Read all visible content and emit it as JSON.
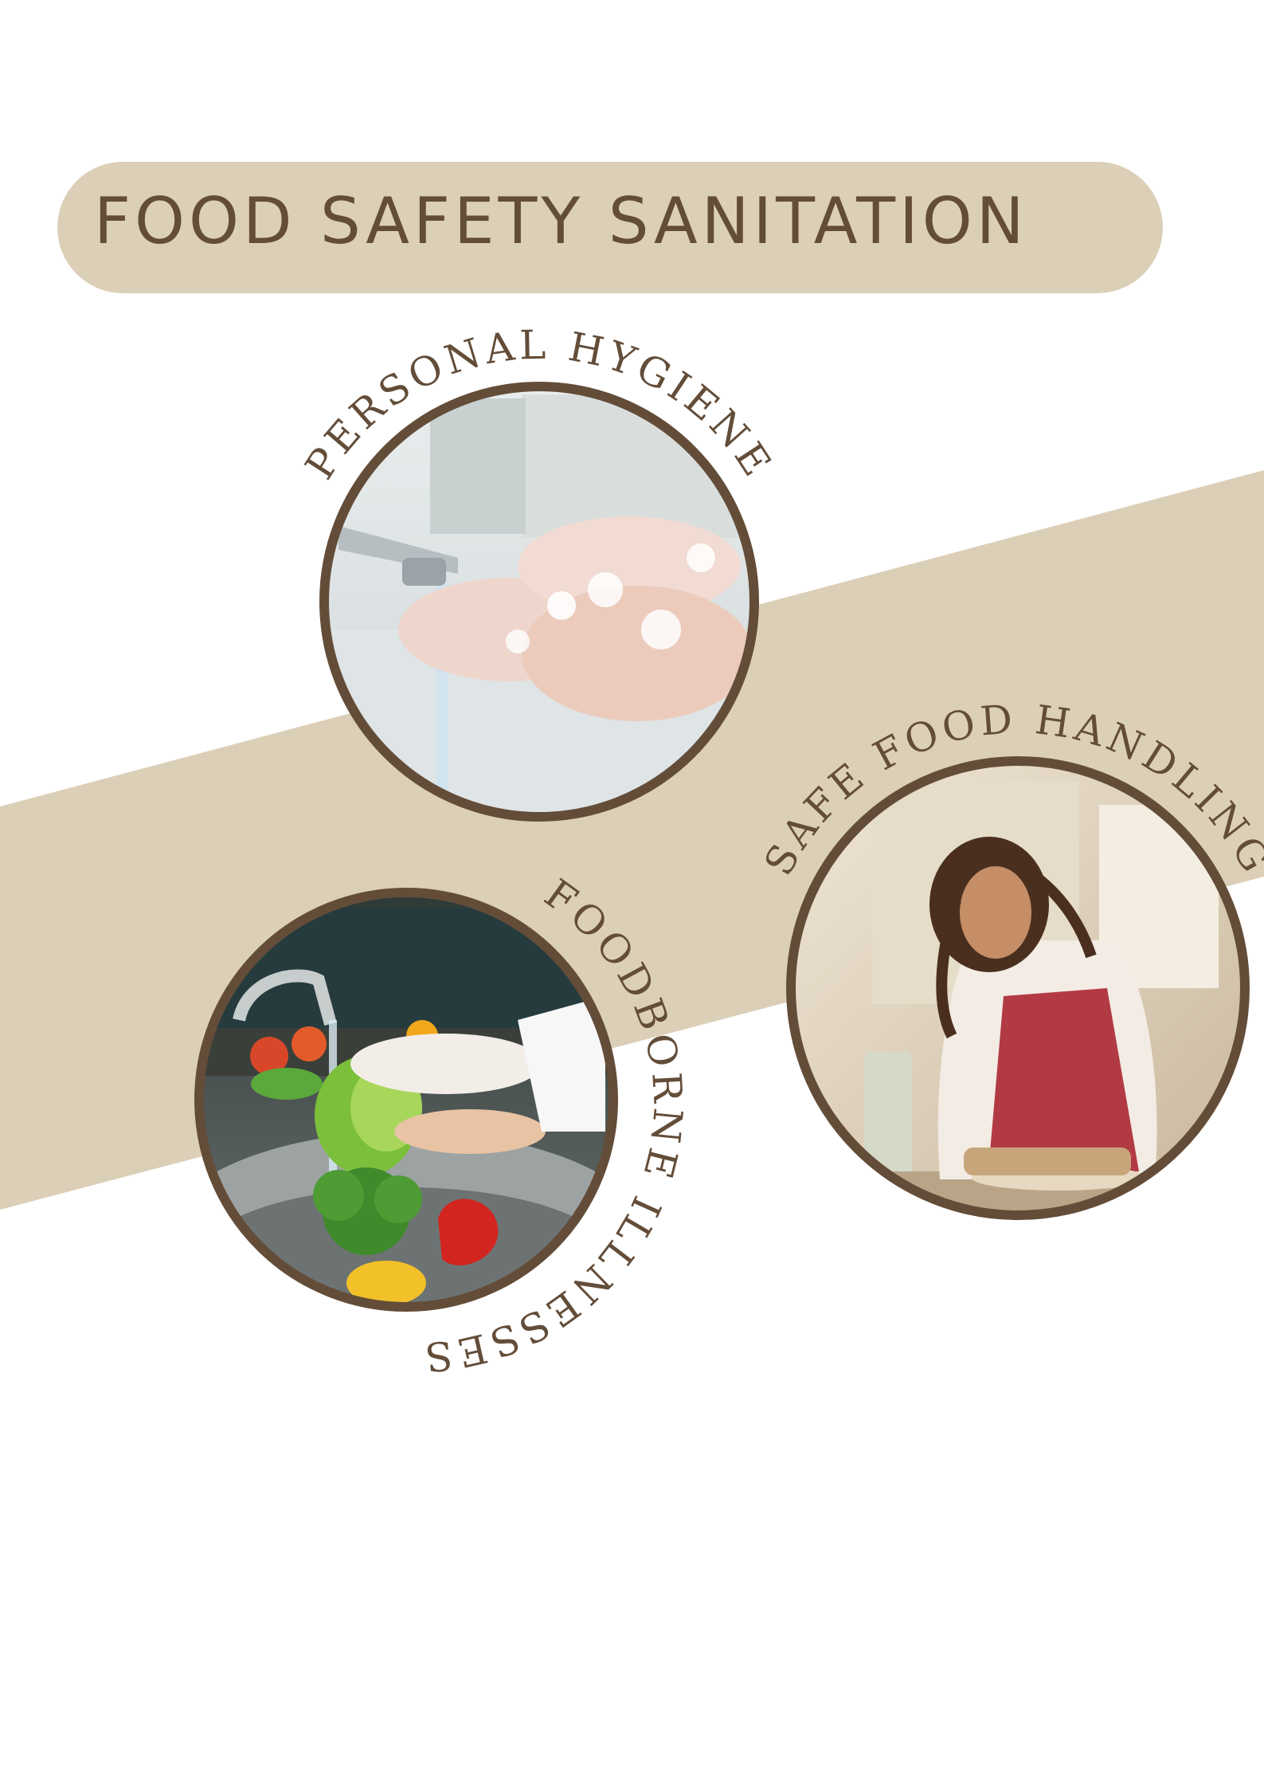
{
  "title": "FOOD SAFETY SANITATION",
  "colors": {
    "accent_beige": "#dccfb8",
    "brown": "#634d39",
    "background": "#ffffff"
  },
  "sections": [
    {
      "label": "PERSONAL HYGIENE",
      "photo": "hands washed with soap under a running faucet"
    },
    {
      "label": "SAFE FOOD HANDLING",
      "photo": "smiling woman in red apron kneading dough"
    },
    {
      "label": "FOODBORNE ILLNESSES",
      "photo": "vegetables rinsed under kitchen tap"
    }
  ]
}
